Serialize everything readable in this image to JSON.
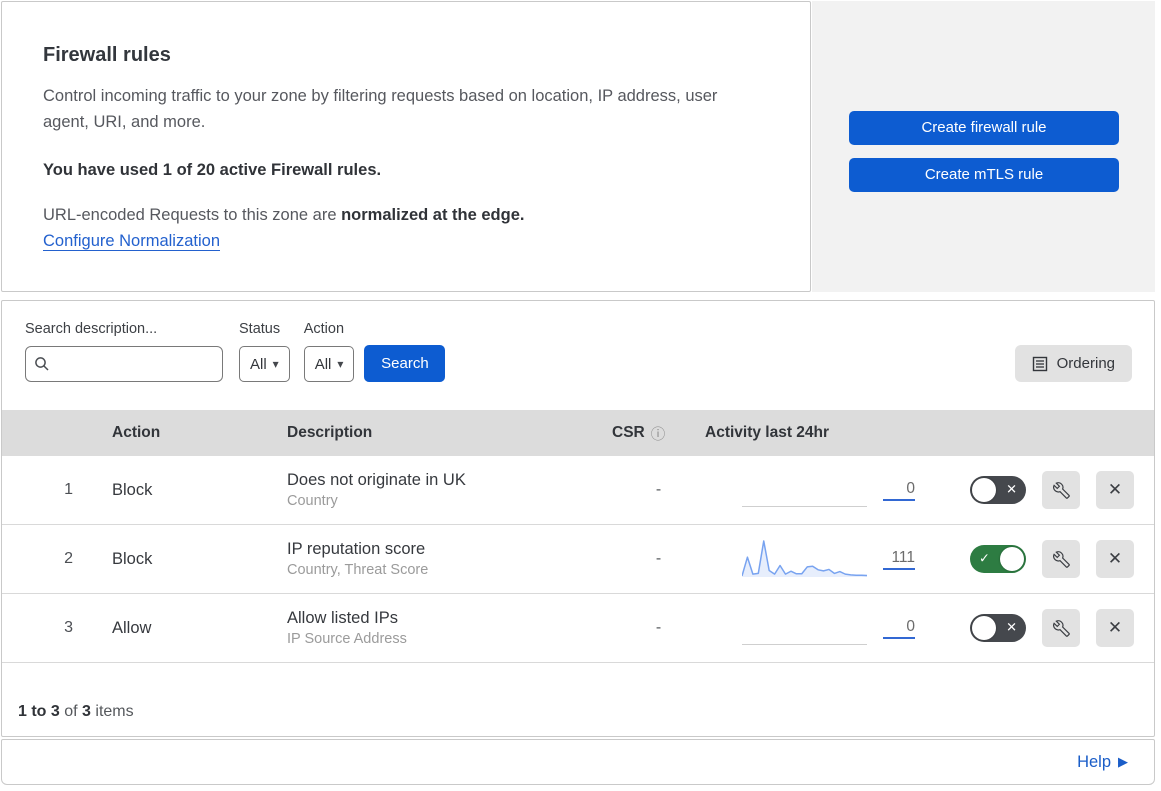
{
  "header": {
    "title": "Firewall rules",
    "description": "Control incoming traffic to your zone by filtering requests based on location, IP address, user agent, URI, and more.",
    "usage": "You have used 1 of 20 active Firewall rules.",
    "normalization_text": "URL-encoded Requests to this zone are ",
    "normalization_bold": "normalized at the edge.",
    "normalization_link": "Configure Normalization"
  },
  "actions_panel": {
    "create_firewall_rule": "Create firewall rule",
    "create_mtls_rule": "Create mTLS rule"
  },
  "filters": {
    "search_label": "Search description...",
    "status_label": "Status",
    "status_value": "All",
    "action_label": "Action",
    "action_value": "All",
    "search_button": "Search",
    "ordering_button": "Ordering"
  },
  "table": {
    "columns": {
      "action": "Action",
      "description": "Description",
      "csr": "CSR",
      "activity": "Activity last 24hr"
    },
    "rows": [
      {
        "priority": "1",
        "action": "Block",
        "description": "Does not originate in UK",
        "fields": "Country",
        "csr": "-",
        "activity_count": "0",
        "enabled": false,
        "sparkline": []
      },
      {
        "priority": "2",
        "action": "Block",
        "description": "IP reputation score",
        "fields": "Country, Threat Score",
        "csr": "-",
        "activity_count": "111",
        "enabled": true,
        "sparkline": [
          3,
          55,
          8,
          10,
          100,
          18,
          8,
          32,
          8,
          16,
          9,
          9,
          28,
          30,
          20,
          17,
          21,
          10,
          15,
          8,
          6,
          5,
          5,
          4
        ]
      },
      {
        "priority": "3",
        "action": "Allow",
        "description": "Allow listed IPs",
        "fields": "IP Source Address",
        "csr": "-",
        "activity_count": "0",
        "enabled": false,
        "sparkline": []
      }
    ]
  },
  "footer": {
    "range": "1 to 3",
    "of": " of ",
    "total": "3",
    "items": " items",
    "help": "Help"
  },
  "icons": {
    "info": "ⓘ",
    "dropdown_caret": "▾",
    "help_arrow": "▶",
    "toggle_on_glyph": "✓",
    "toggle_off_glyph": "✕",
    "close": "✕"
  },
  "colors": {
    "primary_blue": "#0d5cd1",
    "link_blue": "#2361ce",
    "toggle_on_green": "#2d7c42",
    "toggle_off_gray": "#45484d",
    "sparkline_blue": "#78a3f0",
    "panel_gray": "#f2f2f2",
    "table_header_gray": "#dcdcdc"
  }
}
